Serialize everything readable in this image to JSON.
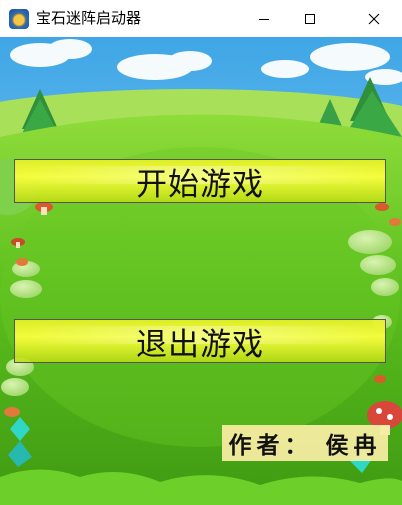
{
  "window": {
    "title": "宝石迷阵启动器",
    "icon": "gem-app-icon",
    "controls": [
      "minimize",
      "maximize",
      "close"
    ]
  },
  "menu": {
    "start_label": "开始游戏",
    "exit_label": "退出游戏"
  },
  "credits": {
    "author_text": "作者： 侯冉"
  },
  "colors": {
    "button_fill": "#e8f028",
    "sky": "#7cc8f0",
    "grass": "#5cbf1e",
    "author_bg": "#f5eca0"
  }
}
